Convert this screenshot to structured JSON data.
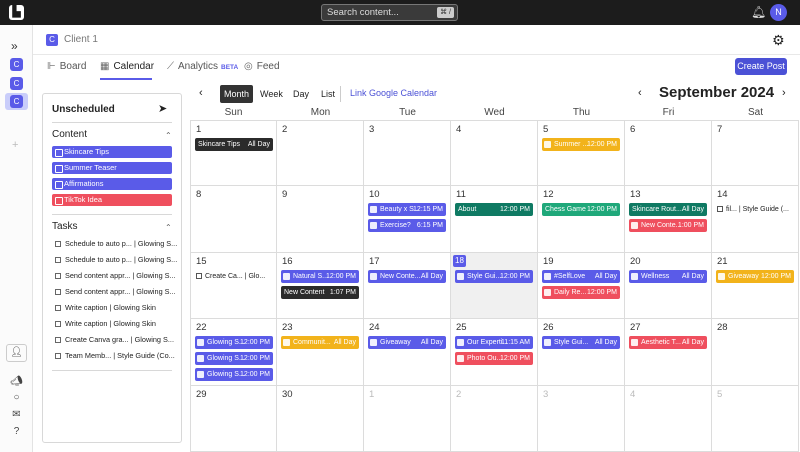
{
  "topbar": {
    "search_placeholder": "Search content...",
    "search_shortcut": "⌘ /",
    "avatar_initial": "N"
  },
  "rail": {
    "clients": [
      "C",
      "C",
      "C"
    ]
  },
  "client": {
    "badge": "C",
    "name": "Client 1"
  },
  "tabs": [
    {
      "label": "Board",
      "icon": "board-icon"
    },
    {
      "label": "Calendar",
      "icon": "calendar-icon"
    },
    {
      "label": "Analytics",
      "icon": "analytics-icon",
      "badge": "BETA"
    },
    {
      "label": "Feed",
      "icon": "instagram-icon"
    }
  ],
  "create_post": "Create Post",
  "panel": {
    "title": "Unscheduled",
    "content_label": "Content",
    "content_items": [
      {
        "label": "Skincare Tips",
        "color": "#5a5be8"
      },
      {
        "label": "Summer Teaser",
        "color": "#5a5be8"
      },
      {
        "label": "Affirmations",
        "color": "#5a5be8"
      },
      {
        "label": "TikTok Idea",
        "color": "#ef4f5e"
      }
    ],
    "tasks_label": "Tasks",
    "tasks": [
      "Schedule to auto p... | Glowing S...",
      "Schedule to auto p... | Glowing S...",
      "Send content appr... | Glowing S...",
      "Send content appr... | Glowing S...",
      "Write caption | Glowing Skin",
      "Write caption | Glowing Skin",
      "Create Canva gra... | Glowing S...",
      "Team Memb... | Style Guide (Co..."
    ]
  },
  "calendar": {
    "views": [
      "Month",
      "Week",
      "Day",
      "List"
    ],
    "active_view": "Month",
    "google_link": "Link Google Calendar",
    "month_title": "September 2024",
    "weekdays": [
      "Sun",
      "Mon",
      "Tue",
      "Wed",
      "Thu",
      "Fri",
      "Sat"
    ],
    "weeks": [
      [
        {
          "d": "1",
          "ev": [
            {
              "t": "Skincare Tips",
              "tm": "All Day",
              "c": "#2b2b2b"
            }
          ]
        },
        {
          "d": "2",
          "ev": []
        },
        {
          "d": "3",
          "ev": []
        },
        {
          "d": "4",
          "ev": []
        },
        {
          "d": "5",
          "ev": [
            {
              "t": "Summer ...",
              "tm": "12:00 PM",
              "c": "#f2b31b",
              "i": 1
            }
          ]
        },
        {
          "d": "6",
          "ev": []
        },
        {
          "d": "7",
          "ev": []
        }
      ],
      [
        {
          "d": "8",
          "ev": []
        },
        {
          "d": "9",
          "ev": []
        },
        {
          "d": "10",
          "ev": [
            {
              "t": "Beauty x S...",
              "tm": "12:15 PM",
              "c": "#5a5be8",
              "i": 1
            },
            {
              "t": "Exercise?",
              "tm": "6:15 PM",
              "c": "#5a5be8",
              "i": 1
            }
          ]
        },
        {
          "d": "11",
          "ev": [
            {
              "t": "About",
              "tm": "12:00 PM",
              "c": "#0f7a63"
            }
          ]
        },
        {
          "d": "12",
          "ev": [
            {
              "t": "Chess Game",
              "tm": "12:00 PM",
              "c": "#1fa87a"
            }
          ]
        },
        {
          "d": "13",
          "ev": [
            {
              "t": "Skincare Rout...",
              "tm": "All Day",
              "c": "#0f7a63"
            },
            {
              "t": "New Conte...",
              "tm": "1:00 PM",
              "c": "#ef4f5e",
              "i": 1
            }
          ]
        },
        {
          "d": "14",
          "ev": [
            {
              "t": "fil... | Style Guide (...",
              "tm": "",
              "c": "plain"
            }
          ]
        }
      ],
      [
        {
          "d": "15",
          "ev": [
            {
              "t": "Create Ca... | Glo...",
              "tm": "",
              "c": "plain"
            }
          ]
        },
        {
          "d": "16",
          "ev": [
            {
              "t": "Natural S...",
              "tm": "12:00 PM",
              "c": "#5a5be8",
              "i": 1
            },
            {
              "t": "New Content",
              "tm": "1:07 PM",
              "c": "#2b2b2b"
            }
          ]
        },
        {
          "d": "17",
          "ev": [
            {
              "t": "New Conte...",
              "tm": "All Day",
              "c": "#5a5be8",
              "i": 1
            }
          ]
        },
        {
          "d": "18",
          "today": true,
          "ev": [
            {
              "t": "Style Gui...",
              "tm": "12:00 PM",
              "c": "#5a5be8",
              "i": 1
            }
          ]
        },
        {
          "d": "19",
          "ev": [
            {
              "t": "#SelfLove",
              "tm": "All Day",
              "c": "#5a5be8",
              "i": 1
            },
            {
              "t": "Daily Re...",
              "tm": "12:00 PM",
              "c": "#ef4f5e",
              "i": 1
            }
          ]
        },
        {
          "d": "20",
          "ev": [
            {
              "t": "Wellness",
              "tm": "All Day",
              "c": "#5a5be8",
              "i": 1
            }
          ]
        },
        {
          "d": "21",
          "ev": [
            {
              "t": "Giveaway",
              "tm": "12:00 PM",
              "c": "#f2b31b",
              "i": 1
            }
          ]
        }
      ],
      [
        {
          "d": "22",
          "ev": [
            {
              "t": "Glowing S...",
              "tm": "12:00 PM",
              "c": "#5a5be8",
              "i": 1
            },
            {
              "t": "Glowing S...",
              "tm": "12:00 PM",
              "c": "#5a5be8",
              "i": 1
            },
            {
              "t": "Glowing S...",
              "tm": "12:00 PM",
              "c": "#5a5be8",
              "i": 1
            }
          ]
        },
        {
          "d": "23",
          "ev": [
            {
              "t": "Communit...",
              "tm": "All Day",
              "c": "#f2b31b",
              "i": 1
            }
          ]
        },
        {
          "d": "24",
          "ev": [
            {
              "t": "Giveaway",
              "tm": "All Day",
              "c": "#5a5be8",
              "i": 1
            }
          ]
        },
        {
          "d": "25",
          "ev": [
            {
              "t": "Our Experti...",
              "tm": "11:15 AM",
              "c": "#5a5be8",
              "i": 1
            },
            {
              "t": "Photo Ou...",
              "tm": "12:00 PM",
              "c": "#ef4f5e",
              "i": 1
            }
          ]
        },
        {
          "d": "26",
          "ev": [
            {
              "t": "Style Gui...",
              "tm": "All Day",
              "c": "#5a5be8",
              "i": 1
            }
          ]
        },
        {
          "d": "27",
          "ev": [
            {
              "t": "Aesthetic T...",
              "tm": "All Day",
              "c": "#ef4f5e",
              "i": 1
            }
          ]
        },
        {
          "d": "28",
          "ev": []
        }
      ],
      [
        {
          "d": "29",
          "ev": []
        },
        {
          "d": "30",
          "ev": []
        },
        {
          "d": "1",
          "muted": true,
          "ev": []
        },
        {
          "d": "2",
          "muted": true,
          "ev": []
        },
        {
          "d": "3",
          "muted": true,
          "ev": []
        },
        {
          "d": "4",
          "muted": true,
          "ev": []
        },
        {
          "d": "5",
          "muted": true,
          "ev": []
        }
      ]
    ]
  }
}
